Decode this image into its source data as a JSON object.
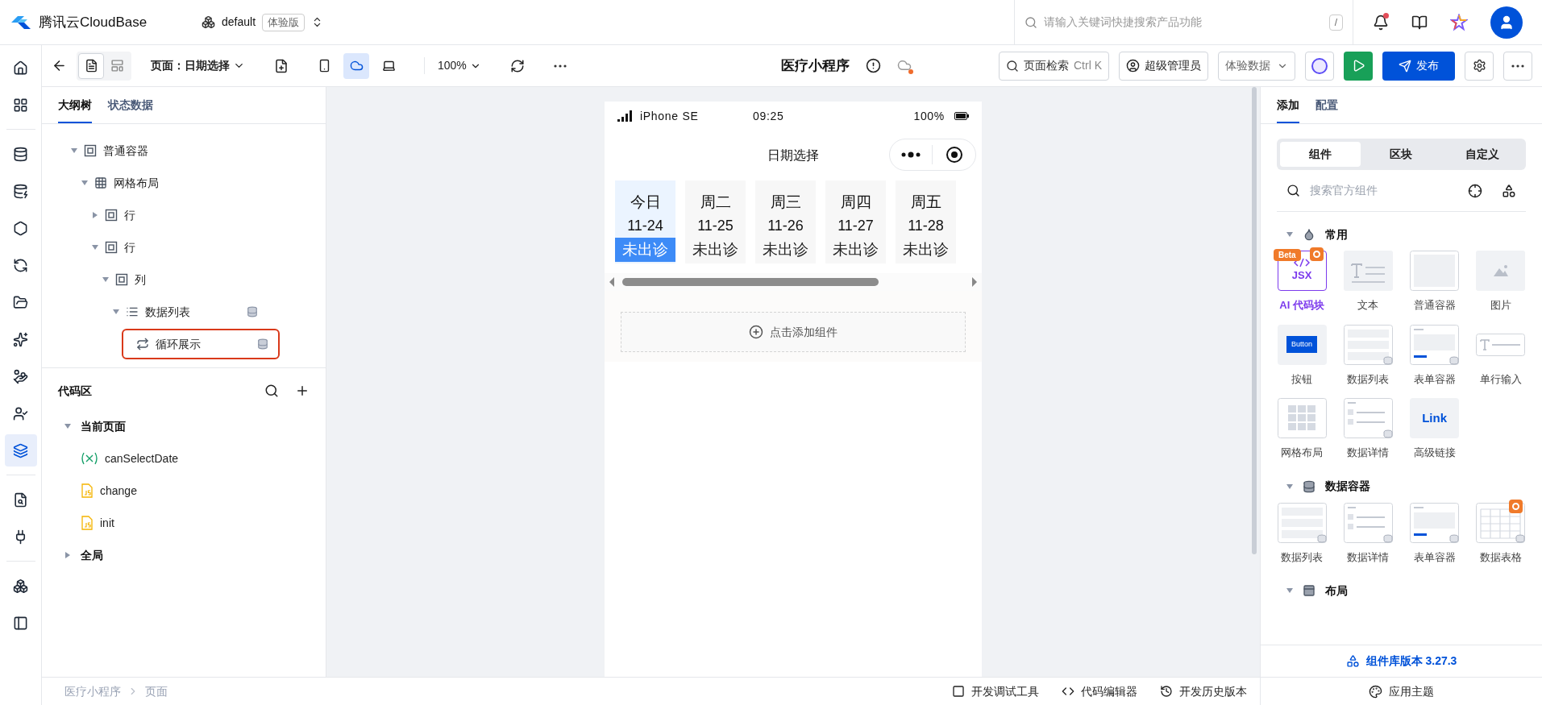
{
  "top_bar": {
    "brand": "腾讯云CloudBase",
    "env": "default",
    "env_badge": "体验版",
    "search_placeholder": "请输入关键词快捷搜索产品功能",
    "search_key": "/",
    "has_notification": true
  },
  "rail": [
    {
      "kind": "home",
      "selected": false
    },
    {
      "kind": "apps",
      "selected": false
    },
    {
      "kind": "divider"
    },
    {
      "kind": "database",
      "selected": false
    },
    {
      "kind": "database-user",
      "selected": false
    },
    {
      "kind": "shield",
      "selected": false
    },
    {
      "kind": "sync",
      "selected": false
    },
    {
      "kind": "folder-cloud",
      "selected": false
    },
    {
      "kind": "sparkles",
      "selected": false
    },
    {
      "kind": "hand",
      "selected": false
    },
    {
      "kind": "user-check",
      "selected": false
    },
    {
      "kind": "lowcode",
      "selected": true
    },
    {
      "kind": "divider"
    },
    {
      "kind": "file-eye",
      "selected": false
    },
    {
      "kind": "plug",
      "selected": false
    },
    {
      "kind": "divider"
    },
    {
      "kind": "cube",
      "selected": false
    },
    {
      "kind": "panel",
      "selected": false
    }
  ],
  "toolbar": {
    "views": [
      {
        "kind": "page",
        "selected": true
      },
      {
        "kind": "layout",
        "selected": false
      }
    ],
    "page_label": "页面：日期选择",
    "devices": [
      {
        "kind": "phone",
        "selected": false
      },
      {
        "kind": "miniprogram",
        "selected": true
      },
      {
        "kind": "desktop",
        "selected": false
      }
    ],
    "zoom": "100%",
    "app_title": "医疗小程序",
    "page_search": "页面检索",
    "page_search_key": "Ctrl K",
    "role": "超级管理员",
    "data_mode": "体验数据",
    "publish": "发布"
  },
  "left_panel": {
    "tabs": [
      {
        "label": "大纲树",
        "selected": true
      },
      {
        "label": "状态数据",
        "selected": false
      }
    ],
    "tree": [
      {
        "label": "普通容器",
        "kind": "container",
        "expanded": true,
        "children": [
          {
            "label": "网格布局",
            "kind": "grid",
            "expanded": true,
            "children": [
              {
                "label": "行",
                "kind": "container",
                "expanded": false
              },
              {
                "label": "行",
                "kind": "container",
                "expanded": true,
                "children": [
                  {
                    "label": "列",
                    "kind": "container",
                    "expanded": true,
                    "children": [
                      {
                        "label": "数据列表",
                        "kind": "list",
                        "expanded": true,
                        "data_bound": true,
                        "children": [
                          {
                            "label": "循环展示",
                            "kind": "loop",
                            "data_bound": true,
                            "selected": true
                          }
                        ]
                      }
                    ]
                  }
                ]
              }
            ]
          }
        ]
      }
    ]
  },
  "code_area": {
    "title": "代码区",
    "groups": [
      {
        "label": "当前页面",
        "expanded": true,
        "items": [
          {
            "kind": "variable",
            "name": "canSelectDate"
          },
          {
            "kind": "js",
            "name": "change"
          },
          {
            "kind": "js",
            "name": "init"
          }
        ]
      },
      {
        "label": "全局",
        "expanded": false
      }
    ]
  },
  "phone": {
    "carrier": "iPhone SE",
    "time": "09:25",
    "battery": "100%",
    "title": "日期选择",
    "days": [
      {
        "weekday": "今日",
        "date": "11-24",
        "status": "未出诊",
        "selected": true
      },
      {
        "weekday": "周二",
        "date": "11-25",
        "status": "未出诊",
        "selected": false
      },
      {
        "weekday": "周三",
        "date": "11-26",
        "status": "未出诊",
        "selected": false
      },
      {
        "weekday": "周四",
        "date": "11-27",
        "status": "未出诊",
        "selected": false
      },
      {
        "weekday": "周五",
        "date": "11-28",
        "status": "未出诊",
        "selected": false
      }
    ],
    "add_component": "点击添加组件"
  },
  "right_panel": {
    "tabs": [
      {
        "label": "添加",
        "selected": true
      },
      {
        "label": "配置",
        "selected": false
      }
    ],
    "segments": [
      {
        "label": "组件",
        "selected": true
      },
      {
        "label": "区块",
        "selected": false
      },
      {
        "label": "自定义",
        "selected": false
      }
    ],
    "search_placeholder": "搜索官方组件",
    "sections": [
      {
        "title": "常用",
        "kind": "drop",
        "expanded": true,
        "items": [
          {
            "kind": "jsx",
            "label": "AI 代码块",
            "preview_text": "JSX",
            "badge": "Beta",
            "hot": true
          },
          {
            "kind": "text",
            "label": "文本"
          },
          {
            "kind": "container",
            "label": "普通容器"
          },
          {
            "kind": "image",
            "label": "图片"
          },
          {
            "kind": "button",
            "label": "按钮",
            "preview_text": "Button"
          },
          {
            "kind": "list",
            "label": "数据列表"
          },
          {
            "kind": "form",
            "label": "表单容器"
          },
          {
            "kind": "input",
            "label": "单行输入"
          },
          {
            "kind": "grid",
            "label": "网格布局"
          },
          {
            "kind": "detail",
            "label": "数据详情"
          },
          {
            "kind": "link",
            "label": "高级链接",
            "preview_text": "Link"
          }
        ]
      },
      {
        "title": "数据容器",
        "kind": "database",
        "expanded": true,
        "items": [
          {
            "kind": "list",
            "label": "数据列表"
          },
          {
            "kind": "detail",
            "label": "数据详情"
          },
          {
            "kind": "form",
            "label": "表单容器"
          },
          {
            "kind": "table",
            "label": "数据表格",
            "hot": true
          }
        ]
      },
      {
        "title": "布局",
        "kind": "layout",
        "expanded": true
      }
    ],
    "version": "组件库版本 3.27.3"
  },
  "bottom_bar": {
    "breadcrumb": [
      "医疗小程序",
      "页面"
    ],
    "tools": [
      {
        "kind": "debug",
        "label": "开发调试工具"
      },
      {
        "kind": "code",
        "label": "代码编辑器"
      },
      {
        "kind": "history",
        "label": "开发历史版本"
      }
    ],
    "theme": "应用主题"
  }
}
